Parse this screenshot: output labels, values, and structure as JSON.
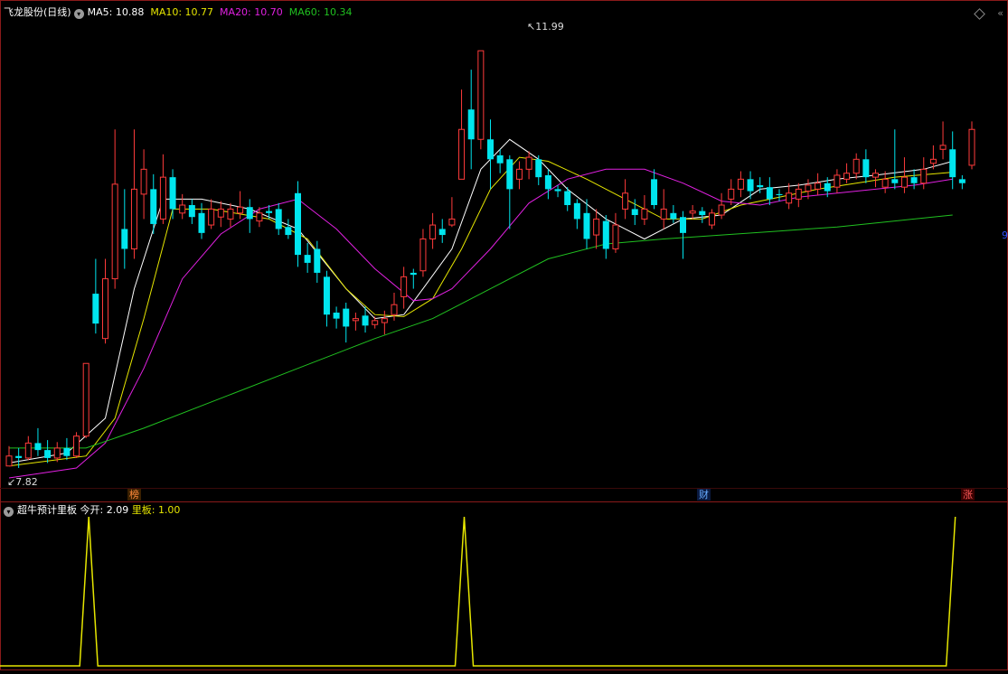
{
  "header": {
    "stock_title": "飞龙股份(日线)",
    "ma5_label": "MA5:",
    "ma5_value": "10.88",
    "ma10_label": "MA10:",
    "ma10_value": "10.77",
    "ma20_label": "MA20:",
    "ma20_value": "10.70",
    "ma60_label": "MA60:",
    "ma60_value": "10.34"
  },
  "annotations": {
    "high": "11.99",
    "low": "7.82",
    "edge_label": "9"
  },
  "event_markers": {
    "m1": "榜",
    "m2": "财",
    "m3": "涨"
  },
  "indicator": {
    "name": "超牛预计里板",
    "open_label": "今开:",
    "open_value": "2.09",
    "board_label": "里板:",
    "board_value": "1.00"
  },
  "colors": {
    "up": "#ff3b3b",
    "down": "#00e5ee",
    "ma5": "#ffffff",
    "ma10": "#e6e600",
    "ma20": "#e020e0",
    "ma60": "#20c020",
    "indicator_line": "#e6e600",
    "grid_border": "#8a1a1a"
  },
  "chart_data": {
    "type": "candlestick",
    "title": "飞龙股份(日线)",
    "y_range": [
      7.6,
      12.3
    ],
    "candles": [
      {
        "o": 7.82,
        "c": 7.92,
        "h": 8.02,
        "l": 7.82
      },
      {
        "o": 7.92,
        "c": 7.9,
        "h": 8.0,
        "l": 7.8
      },
      {
        "o": 7.9,
        "c": 8.05,
        "h": 8.12,
        "l": 7.88
      },
      {
        "o": 8.05,
        "c": 7.98,
        "h": 8.2,
        "l": 7.92
      },
      {
        "o": 7.98,
        "c": 7.9,
        "h": 8.08,
        "l": 7.85
      },
      {
        "o": 7.9,
        "c": 8.0,
        "h": 8.06,
        "l": 7.86
      },
      {
        "o": 8.0,
        "c": 7.92,
        "h": 8.1,
        "l": 7.88
      },
      {
        "o": 7.92,
        "c": 8.12,
        "h": 8.16,
        "l": 7.9
      },
      {
        "o": 8.12,
        "c": 8.85,
        "h": 8.85,
        "l": 8.1
      },
      {
        "o": 9.55,
        "c": 9.25,
        "h": 9.9,
        "l": 9.15
      },
      {
        "o": 9.1,
        "c": 9.7,
        "h": 9.9,
        "l": 9.05
      },
      {
        "o": 9.7,
        "c": 10.65,
        "h": 11.2,
        "l": 9.6
      },
      {
        "o": 10.2,
        "c": 10.0,
        "h": 10.6,
        "l": 9.8
      },
      {
        "o": 10.0,
        "c": 10.6,
        "h": 11.2,
        "l": 9.9
      },
      {
        "o": 10.55,
        "c": 10.8,
        "h": 11.0,
        "l": 10.3
      },
      {
        "o": 10.6,
        "c": 10.25,
        "h": 10.75,
        "l": 10.15
      },
      {
        "o": 10.3,
        "c": 10.72,
        "h": 10.95,
        "l": 10.25
      },
      {
        "o": 10.72,
        "c": 10.4,
        "h": 10.8,
        "l": 10.3
      },
      {
        "o": 10.36,
        "c": 10.44,
        "h": 10.55,
        "l": 10.3
      },
      {
        "o": 10.44,
        "c": 10.32,
        "h": 10.5,
        "l": 10.25
      },
      {
        "o": 10.36,
        "c": 10.16,
        "h": 10.46,
        "l": 10.1
      },
      {
        "o": 10.24,
        "c": 10.4,
        "h": 10.5,
        "l": 10.2
      },
      {
        "o": 10.32,
        "c": 10.4,
        "h": 10.48,
        "l": 10.22
      },
      {
        "o": 10.3,
        "c": 10.4,
        "h": 10.46,
        "l": 10.22
      },
      {
        "o": 10.36,
        "c": 10.42,
        "h": 10.58,
        "l": 10.3
      },
      {
        "o": 10.42,
        "c": 10.3,
        "h": 10.5,
        "l": 10.16
      },
      {
        "o": 10.28,
        "c": 10.36,
        "h": 10.42,
        "l": 10.22
      },
      {
        "o": 10.38,
        "c": 10.36,
        "h": 10.44,
        "l": 10.3
      },
      {
        "o": 10.4,
        "c": 10.2,
        "h": 10.46,
        "l": 10.14
      },
      {
        "o": 10.22,
        "c": 10.14,
        "h": 10.3,
        "l": 10.1
      },
      {
        "o": 10.56,
        "c": 9.94,
        "h": 10.68,
        "l": 9.82
      },
      {
        "o": 9.94,
        "c": 9.86,
        "h": 10.06,
        "l": 9.76
      },
      {
        "o": 10.0,
        "c": 9.76,
        "h": 10.08,
        "l": 9.66
      },
      {
        "o": 9.72,
        "c": 9.34,
        "h": 9.78,
        "l": 9.22
      },
      {
        "o": 9.36,
        "c": 9.3,
        "h": 9.42,
        "l": 9.2
      },
      {
        "o": 9.4,
        "c": 9.22,
        "h": 9.46,
        "l": 9.06
      },
      {
        "o": 9.28,
        "c": 9.3,
        "h": 9.36,
        "l": 9.18
      },
      {
        "o": 9.33,
        "c": 9.23,
        "h": 9.42,
        "l": 9.16
      },
      {
        "o": 9.24,
        "c": 9.28,
        "h": 9.32,
        "l": 9.2
      },
      {
        "o": 9.26,
        "c": 9.3,
        "h": 9.38,
        "l": 9.14
      },
      {
        "o": 9.34,
        "c": 9.44,
        "h": 9.56,
        "l": 9.28
      },
      {
        "o": 9.52,
        "c": 9.72,
        "h": 9.82,
        "l": 9.4
      },
      {
        "o": 9.76,
        "c": 9.74,
        "h": 9.8,
        "l": 9.6
      },
      {
        "o": 9.78,
        "c": 10.1,
        "h": 10.2,
        "l": 9.72
      },
      {
        "o": 10.1,
        "c": 10.24,
        "h": 10.36,
        "l": 10.0
      },
      {
        "o": 10.2,
        "c": 10.14,
        "h": 10.3,
        "l": 10.06
      },
      {
        "o": 10.24,
        "c": 10.3,
        "h": 10.52,
        "l": 10.22
      },
      {
        "o": 10.7,
        "c": 11.2,
        "h": 11.6,
        "l": 10.7
      },
      {
        "o": 11.4,
        "c": 11.1,
        "h": 11.8,
        "l": 10.8
      },
      {
        "o": 11.1,
        "c": 11.99,
        "h": 11.99,
        "l": 11.0
      },
      {
        "o": 11.1,
        "c": 10.9,
        "h": 11.3,
        "l": 10.6
      },
      {
        "o": 10.94,
        "c": 10.86,
        "h": 11.0,
        "l": 10.76
      },
      {
        "o": 10.9,
        "c": 10.6,
        "h": 10.94,
        "l": 10.2
      },
      {
        "o": 10.7,
        "c": 10.8,
        "h": 10.88,
        "l": 10.6
      },
      {
        "o": 10.8,
        "c": 10.92,
        "h": 10.98,
        "l": 10.7
      },
      {
        "o": 10.9,
        "c": 10.72,
        "h": 10.94,
        "l": 10.64
      },
      {
        "o": 10.74,
        "c": 10.6,
        "h": 10.8,
        "l": 10.5
      },
      {
        "o": 10.6,
        "c": 10.58,
        "h": 10.64,
        "l": 10.52
      },
      {
        "o": 10.58,
        "c": 10.44,
        "h": 10.62,
        "l": 10.38
      },
      {
        "o": 10.46,
        "c": 10.3,
        "h": 10.5,
        "l": 10.2
      },
      {
        "o": 10.36,
        "c": 10.1,
        "h": 10.5,
        "l": 10.0
      },
      {
        "o": 10.14,
        "c": 10.3,
        "h": 10.4,
        "l": 10.0
      },
      {
        "o": 10.28,
        "c": 10.0,
        "h": 10.34,
        "l": 9.9
      },
      {
        "o": 10.0,
        "c": 10.24,
        "h": 10.36,
        "l": 9.96
      },
      {
        "o": 10.4,
        "c": 10.56,
        "h": 10.7,
        "l": 10.3
      },
      {
        "o": 10.4,
        "c": 10.34,
        "h": 10.5,
        "l": 10.24
      },
      {
        "o": 10.3,
        "c": 10.4,
        "h": 10.54,
        "l": 10.24
      },
      {
        "o": 10.7,
        "c": 10.44,
        "h": 10.8,
        "l": 10.4
      },
      {
        "o": 10.3,
        "c": 10.4,
        "h": 10.6,
        "l": 10.2
      },
      {
        "o": 10.36,
        "c": 10.3,
        "h": 10.44,
        "l": 10.26
      },
      {
        "o": 10.32,
        "c": 10.16,
        "h": 10.38,
        "l": 9.9
      },
      {
        "o": 10.36,
        "c": 10.38,
        "h": 10.44,
        "l": 10.3
      },
      {
        "o": 10.38,
        "c": 10.34,
        "h": 10.42,
        "l": 10.26
      },
      {
        "o": 10.24,
        "c": 10.36,
        "h": 10.4,
        "l": 10.2
      },
      {
        "o": 10.34,
        "c": 10.44,
        "h": 10.56,
        "l": 10.3
      },
      {
        "o": 10.5,
        "c": 10.6,
        "h": 10.7,
        "l": 10.44
      },
      {
        "o": 10.6,
        "c": 10.7,
        "h": 10.78,
        "l": 10.52
      },
      {
        "o": 10.7,
        "c": 10.58,
        "h": 10.78,
        "l": 10.5
      },
      {
        "o": 10.64,
        "c": 10.62,
        "h": 10.72,
        "l": 10.56
      },
      {
        "o": 10.62,
        "c": 10.5,
        "h": 10.72,
        "l": 10.44
      },
      {
        "o": 10.55,
        "c": 10.54,
        "h": 10.6,
        "l": 10.48
      },
      {
        "o": 10.46,
        "c": 10.56,
        "h": 10.66,
        "l": 10.4
      },
      {
        "o": 10.5,
        "c": 10.6,
        "h": 10.66,
        "l": 10.42
      },
      {
        "o": 10.58,
        "c": 10.64,
        "h": 10.7,
        "l": 10.5
      },
      {
        "o": 10.6,
        "c": 10.66,
        "h": 10.76,
        "l": 10.54
      },
      {
        "o": 10.66,
        "c": 10.58,
        "h": 10.72,
        "l": 10.52
      },
      {
        "o": 10.62,
        "c": 10.74,
        "h": 10.8,
        "l": 10.56
      },
      {
        "o": 10.7,
        "c": 10.76,
        "h": 10.86,
        "l": 10.66
      },
      {
        "o": 10.76,
        "c": 10.9,
        "h": 10.96,
        "l": 10.7
      },
      {
        "o": 10.9,
        "c": 10.72,
        "h": 11.0,
        "l": 10.66
      },
      {
        "o": 10.72,
        "c": 10.76,
        "h": 10.8,
        "l": 10.62
      },
      {
        "o": 10.62,
        "c": 10.7,
        "h": 10.78,
        "l": 10.56
      },
      {
        "o": 10.7,
        "c": 10.66,
        "h": 11.2,
        "l": 10.6
      },
      {
        "o": 10.62,
        "c": 10.72,
        "h": 10.92,
        "l": 10.56
      },
      {
        "o": 10.72,
        "c": 10.66,
        "h": 10.8,
        "l": 10.6
      },
      {
        "o": 10.66,
        "c": 10.8,
        "h": 10.92,
        "l": 10.6
      },
      {
        "o": 10.86,
        "c": 10.9,
        "h": 11.04,
        "l": 10.8
      },
      {
        "o": 11.0,
        "c": 11.04,
        "h": 11.28,
        "l": 10.9
      },
      {
        "o": 11.0,
        "c": 10.72,
        "h": 11.18,
        "l": 10.6
      },
      {
        "o": 10.7,
        "c": 10.66,
        "h": 10.74,
        "l": 10.6
      },
      {
        "o": 10.84,
        "c": 11.2,
        "h": 11.28,
        "l": 10.8
      }
    ],
    "ma_series": [
      {
        "name": "MA5",
        "x": [
          0,
          6,
          10,
          13,
          16,
          20,
          25,
          30,
          35,
          38,
          41,
          43,
          46,
          49,
          52,
          55,
          58,
          62,
          66,
          70,
          74,
          78,
          82,
          86,
          90,
          95,
          98
        ],
        "y": [
          7.85,
          7.95,
          8.3,
          9.6,
          10.5,
          10.5,
          10.4,
          10.2,
          9.6,
          9.3,
          9.34,
          9.6,
          10.0,
          10.8,
          11.1,
          10.9,
          10.6,
          10.3,
          10.1,
          10.3,
          10.34,
          10.6,
          10.64,
          10.7,
          10.74,
          10.8,
          10.88
        ]
      },
      {
        "name": "MA10",
        "x": [
          0,
          8,
          11,
          14,
          17,
          21,
          27,
          31,
          35,
          38,
          41,
          44,
          47,
          50,
          53,
          56,
          60,
          64,
          68,
          72,
          76,
          80,
          84,
          88,
          92,
          98
        ],
        "y": [
          7.82,
          7.92,
          8.3,
          9.3,
          10.4,
          10.4,
          10.3,
          10.1,
          9.6,
          9.34,
          9.32,
          9.5,
          10.0,
          10.6,
          10.92,
          10.88,
          10.7,
          10.5,
          10.3,
          10.3,
          10.44,
          10.52,
          10.6,
          10.66,
          10.72,
          10.77
        ]
      },
      {
        "name": "MA20",
        "x": [
          0,
          7,
          10,
          14,
          18,
          22,
          26,
          30,
          34,
          38,
          42,
          44,
          46,
          50,
          54,
          58,
          62,
          66,
          70,
          74,
          78,
          82,
          86,
          90,
          94,
          98
        ],
        "y": [
          7.7,
          7.8,
          8.05,
          8.8,
          9.7,
          10.15,
          10.4,
          10.5,
          10.2,
          9.8,
          9.48,
          9.5,
          9.6,
          10.0,
          10.46,
          10.7,
          10.8,
          10.8,
          10.66,
          10.48,
          10.44,
          10.52,
          10.56,
          10.6,
          10.64,
          10.7
        ]
      },
      {
        "name": "MA60",
        "x": [
          0,
          8,
          14,
          22,
          30,
          38,
          44,
          50,
          56,
          62,
          68,
          74,
          80,
          86,
          92,
          98
        ],
        "y": [
          8.0,
          8.0,
          8.2,
          8.5,
          8.8,
          9.1,
          9.3,
          9.6,
          9.9,
          10.05,
          10.1,
          10.14,
          10.18,
          10.22,
          10.28,
          10.34
        ]
      }
    ],
    "indicator_series": {
      "name": "里板",
      "y_range": [
        0,
        1
      ],
      "spikes_at": [
        8,
        47,
        98
      ]
    }
  }
}
